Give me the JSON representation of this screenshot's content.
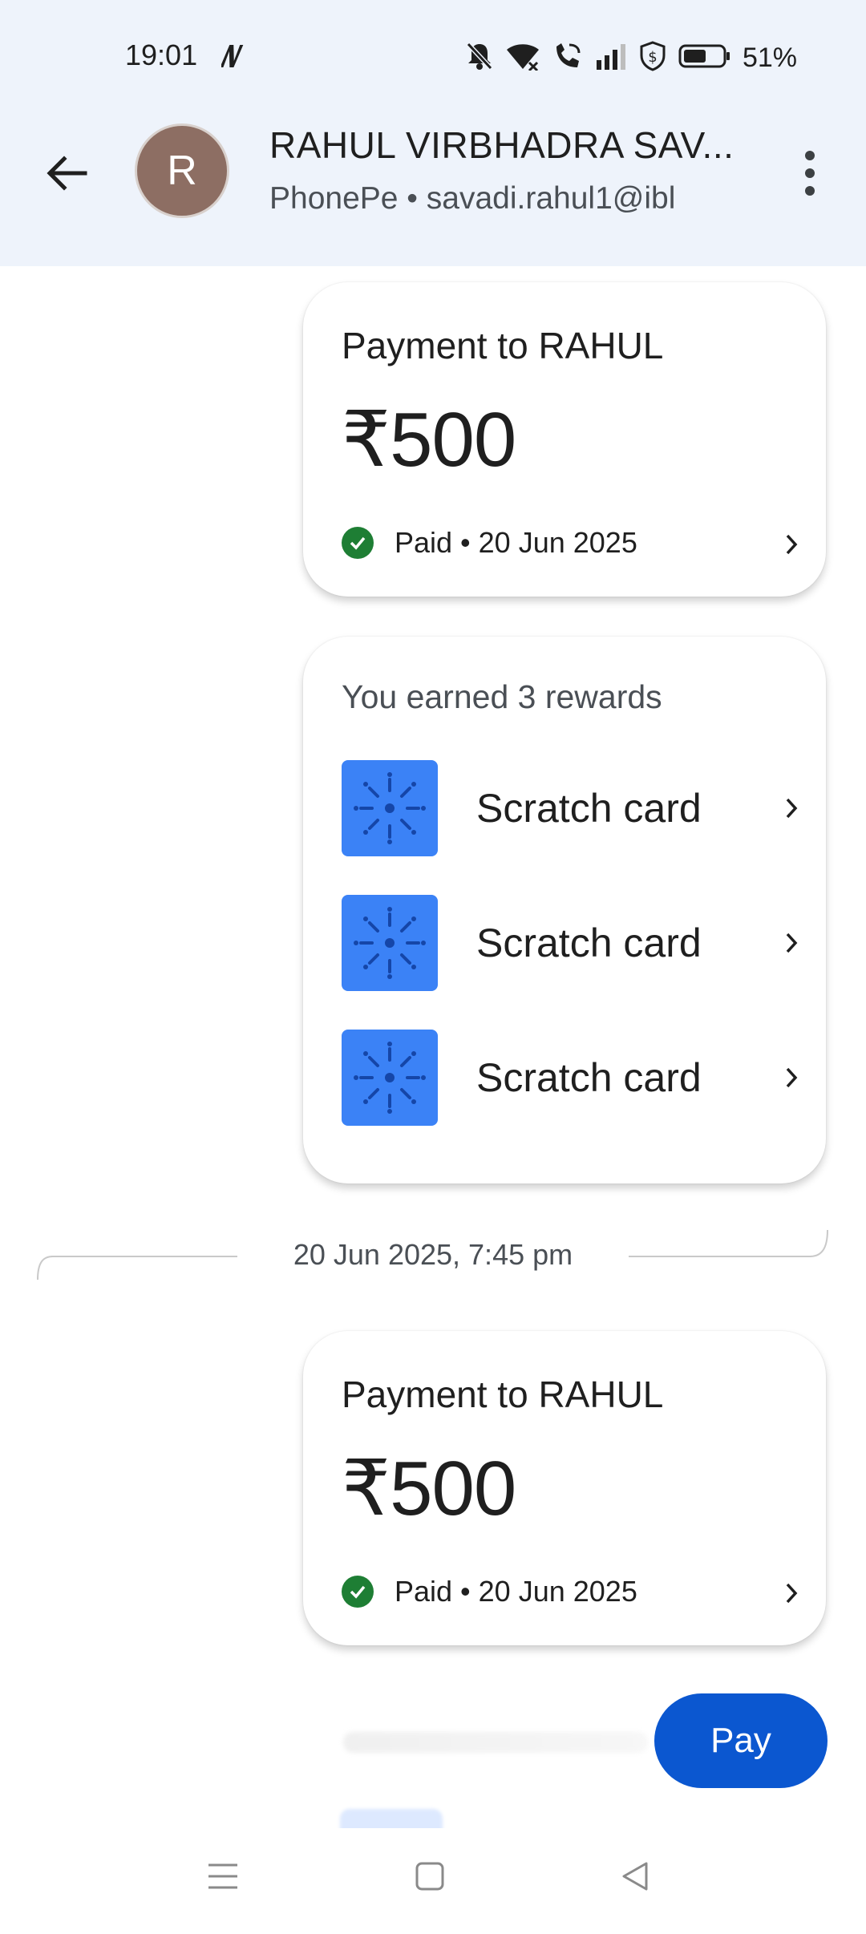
{
  "status_bar": {
    "time": "19:01",
    "battery_percent": "51%",
    "icons": [
      "notification-n-icon",
      "mute-icon",
      "wifi-icon",
      "wifi-call-icon",
      "signal-icon",
      "shield-dollar-icon",
      "battery-icon"
    ]
  },
  "header": {
    "avatar_letter": "R",
    "name": "RAHUL VIRBHADRA SAV...",
    "subtitle": "PhonePe • savadi.rahul1@ibl",
    "colors": {
      "background": "#eef3fb",
      "avatar": "#8d6e63"
    }
  },
  "payments": [
    {
      "title": "Payment to RAHUL",
      "amount": "₹500",
      "status": "Paid • 20 Jun 2025"
    },
    {
      "title": "Payment to RAHUL",
      "amount": "₹500",
      "status": "Paid • 20 Jun 2025"
    }
  ],
  "rewards": {
    "title": "You earned 3 rewards",
    "items": [
      {
        "label": "Scratch card"
      },
      {
        "label": "Scratch card"
      },
      {
        "label": "Scratch card"
      }
    ],
    "color": "#3b82f6"
  },
  "separator": {
    "datetime": "20 Jun 2025, 7:45 pm"
  },
  "pay_button": {
    "label": "Pay",
    "color": "#0b57d0"
  },
  "nav": {
    "icons": [
      "menu-icon",
      "home-square-icon",
      "back-triangle-icon"
    ]
  }
}
